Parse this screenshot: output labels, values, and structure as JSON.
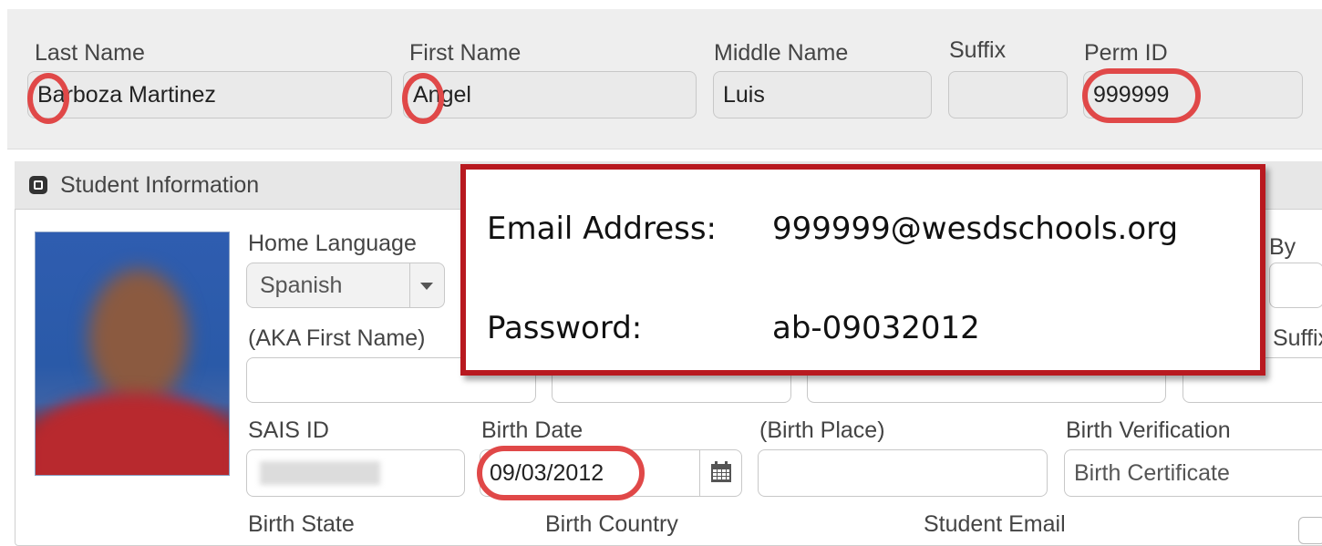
{
  "name_bar": {
    "last_name": {
      "label": "Last Name",
      "value": "Barboza Martinez"
    },
    "first_name": {
      "label": "First Name",
      "value": "Angel"
    },
    "middle_name": {
      "label": "Middle Name",
      "value": "Luis"
    },
    "suffix": {
      "label": "Suffix",
      "value": ""
    },
    "perm_id": {
      "label": "Perm ID",
      "value": "999999"
    }
  },
  "student_info": {
    "title": "Student Information",
    "home_language": {
      "label": "Home Language",
      "value": "Spanish"
    },
    "aka_first_name": {
      "label": "(AKA First Name)",
      "value": ""
    },
    "by_label": "By",
    "suffix_label": "Suffix",
    "sais_id": {
      "label": "SAIS ID",
      "value": ""
    },
    "birth_date": {
      "label": "Birth Date",
      "value": "09/03/2012"
    },
    "birth_place": {
      "label": "(Birth Place)",
      "value": ""
    },
    "birth_verification": {
      "label": "Birth Verification",
      "value": "Birth Certificate"
    },
    "birth_state_label": "Birth State",
    "birth_country_label": "Birth Country",
    "student_email_label": "Student Email"
  },
  "callout": {
    "email_label": "Email Address:",
    "email_value": "999999@wesdschools.org",
    "password_label": "Password:",
    "password_value": "ab-09032012"
  },
  "icons": {
    "collapse": "collapse-square-icon",
    "calendar": "calendar-icon",
    "dropdown": "chevron-down-icon"
  },
  "colors": {
    "highlight_circle": "#e04848",
    "callout_border": "#b8191f",
    "header_bg": "#eeeeee"
  }
}
